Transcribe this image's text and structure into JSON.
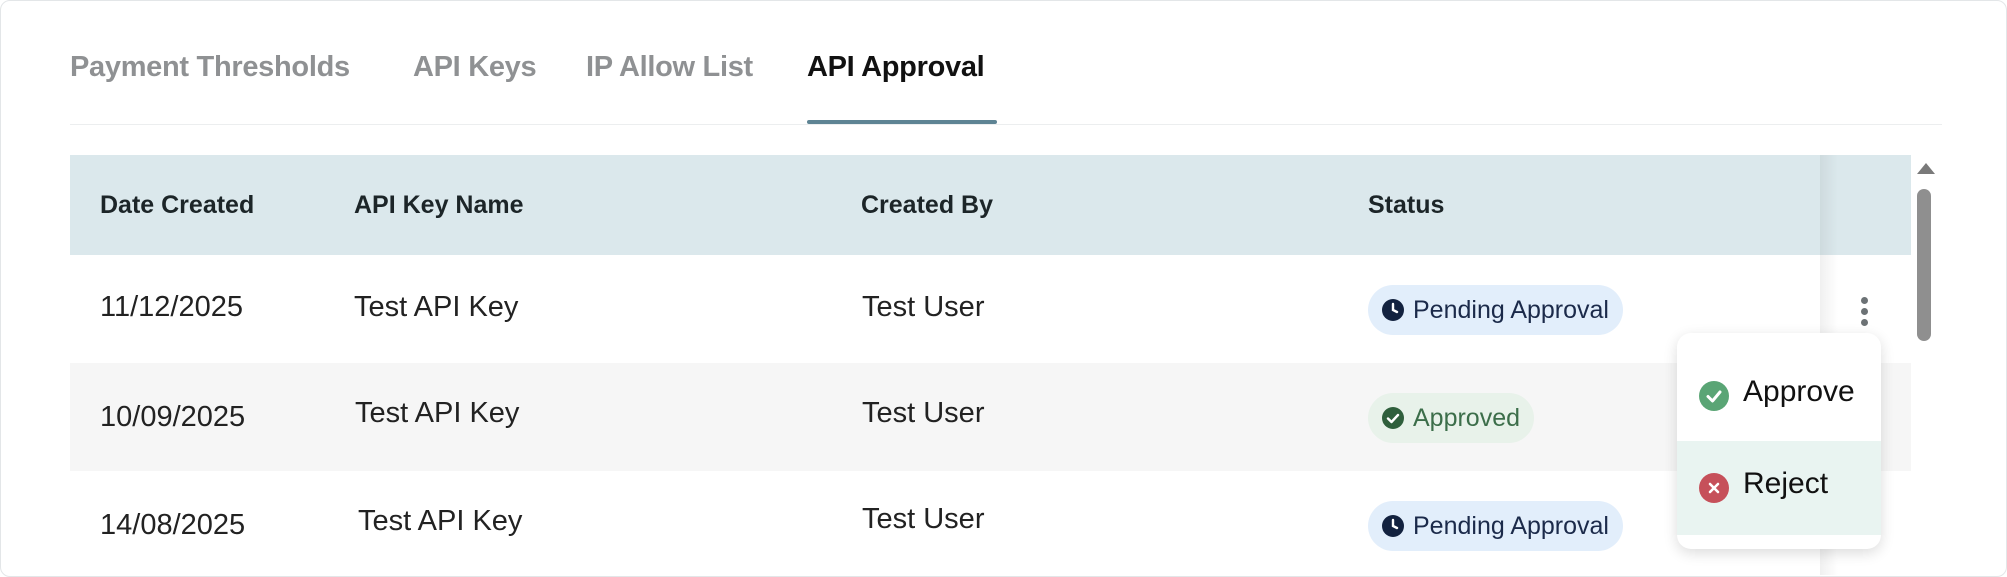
{
  "tabs": [
    {
      "label": "Payment Thresholds",
      "active": false
    },
    {
      "label": "API Keys",
      "active": false
    },
    {
      "label": "IP Allow List",
      "active": false
    },
    {
      "label": "API Approval",
      "active": true
    }
  ],
  "table": {
    "headers": [
      "Date Created",
      "API Key Name",
      "Created By",
      "Status"
    ],
    "rows": [
      {
        "date": "11/12/2025",
        "name": "Test API Key",
        "created_by": "Test User",
        "status": "Pending Approval"
      },
      {
        "date": "10/09/2025",
        "name": "Test API Key",
        "created_by": "Test User",
        "status": "Approved"
      },
      {
        "date": "14/08/2025",
        "name": "Test API Key",
        "created_by": "Test User",
        "status": "Pending Approval"
      }
    ]
  },
  "row_menu": {
    "approve_label": "Approve",
    "reject_label": "Reject"
  },
  "icons": {
    "pending": "clock-icon",
    "approved": "check-circle-icon",
    "reject": "x-circle-icon",
    "more": "more-vertical-icon"
  },
  "colors": {
    "active_tab_underline": "#5e8494",
    "header_bg": "#dbe8ec",
    "pending_badge_bg": "#e2eefb",
    "approved_badge_bg": "#e8f2ea",
    "approve_icon": "#5aa575",
    "reject_icon": "#c6505a"
  }
}
